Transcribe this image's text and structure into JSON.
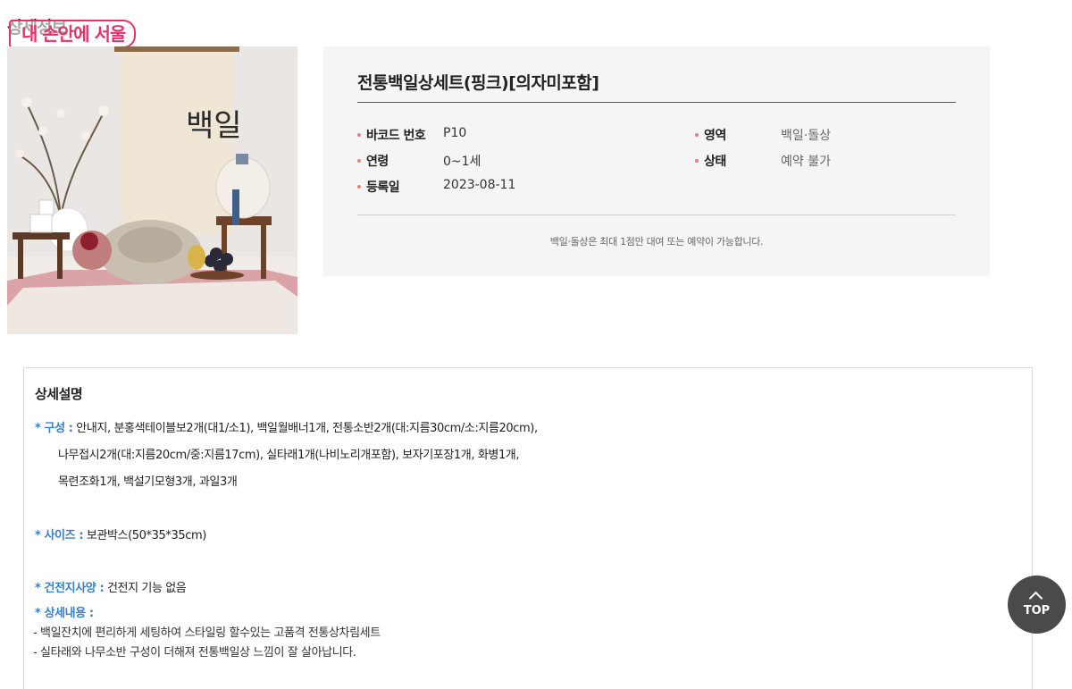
{
  "header": {
    "section_title": "상세정보",
    "brand_badge": "내 손안에 서울"
  },
  "product": {
    "photo_banner_text": "백일",
    "name": "전통백일상세트(핑크)[의자미포함]",
    "fields": [
      {
        "label": "바코드 번호",
        "value": "P10"
      },
      {
        "label": "연령",
        "value": "0~1세"
      },
      {
        "label": "등록일",
        "value": "2023-08-11"
      },
      {
        "label": "영역",
        "value": "백일·돌상"
      },
      {
        "label": "상태",
        "value": "예약 불가"
      }
    ],
    "notice": "백일·돌상은 최대 1점만 대여 또는 예약이 가능합니다."
  },
  "description": {
    "title": "상세설명",
    "composition_key": "* 구성 :",
    "composition_lines": [
      " 안내지, 분홍색테이블보2개(대1/소1), 백일월배너1개, 전통소반2개(대:지름30cm/소:지름20cm),",
      "나무접시2개(대:지름20cm/중:지름17cm), 실타래1개(나비노리개포함), 보자기포장1개, 화병1개,",
      "목련조화1개, 백설기모형3개, 과일3개"
    ],
    "size_key": "* 사이즈 :",
    "size_value": " 보관박스(50*35*35cm)",
    "battery_key": "* 건전지사양 :",
    "battery_value": " 건전지 기능 없음",
    "detail_key": "* 상세내용 :",
    "detail_lines": [
      "- 백일잔치에 편리하게 세팅하여 스타일링 할수있는 고품격 전통상차림세트",
      "- 실타래와 나무소반 구성이 더해져 전통백일상 느낌이 잘 살아납니다."
    ]
  },
  "top_button": {
    "label": "TOP"
  },
  "colors": {
    "accent_pink": "#e4336b",
    "key_blue": "#3b7fc4",
    "bullet": "#e9827c"
  }
}
